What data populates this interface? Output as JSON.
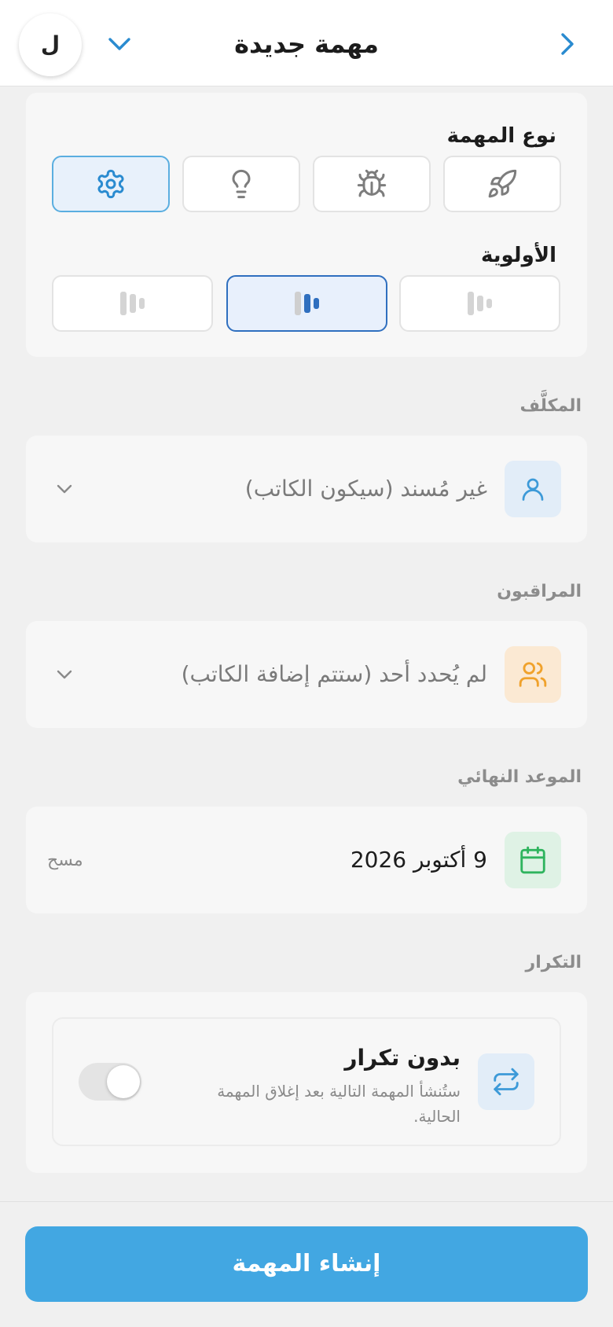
{
  "header": {
    "title": "مهمة جديدة",
    "avatar_letter": "ل",
    "back_icon": "chevron-right-icon",
    "dropdown_icon": "chevron-down-icon"
  },
  "task_type": {
    "label": "نوع المهمة",
    "options": [
      {
        "icon": "rocket-icon",
        "selected": false
      },
      {
        "icon": "bug-icon",
        "selected": false
      },
      {
        "icon": "lightbulb-icon",
        "selected": false
      },
      {
        "icon": "gear-icon",
        "selected": true
      }
    ]
  },
  "priority": {
    "label": "الأولوية",
    "options": [
      {
        "icon": "priority-low-icon",
        "selected": false
      },
      {
        "icon": "priority-medium-icon",
        "selected": true
      },
      {
        "icon": "priority-high-icon",
        "selected": false
      }
    ]
  },
  "assignee": {
    "label": "المكلَّف",
    "value": "غير مُسند (سيكون الكاتب)",
    "icon": "user-icon"
  },
  "watchers": {
    "label": "المراقبون",
    "value": "لم يُحدد أحد (ستتم إضافة الكاتب)",
    "icon": "users-icon"
  },
  "due_date": {
    "label": "الموعد النهائي",
    "value": "9 أكتوبر 2026",
    "clear_label": "مسح",
    "icon": "calendar-icon"
  },
  "recurrence": {
    "label": "التكرار",
    "title": "بدون تكرار",
    "description_line1": "ستُنشأ المهمة التالية بعد إغلاق المهمة",
    "description_line2": "الحالية.",
    "icon": "repeat-icon",
    "enabled": false
  },
  "submit_label": "إنشاء المهمة",
  "colors": {
    "accent": "#42a7e2",
    "selected_border": "#5aaee0",
    "priority_selected": "#2f6fbf",
    "watchers_tile": "#fbe9d3",
    "watchers_icon": "#f0a22c",
    "calendar_tile": "#dff2e5",
    "calendar_icon": "#2fb45e"
  }
}
